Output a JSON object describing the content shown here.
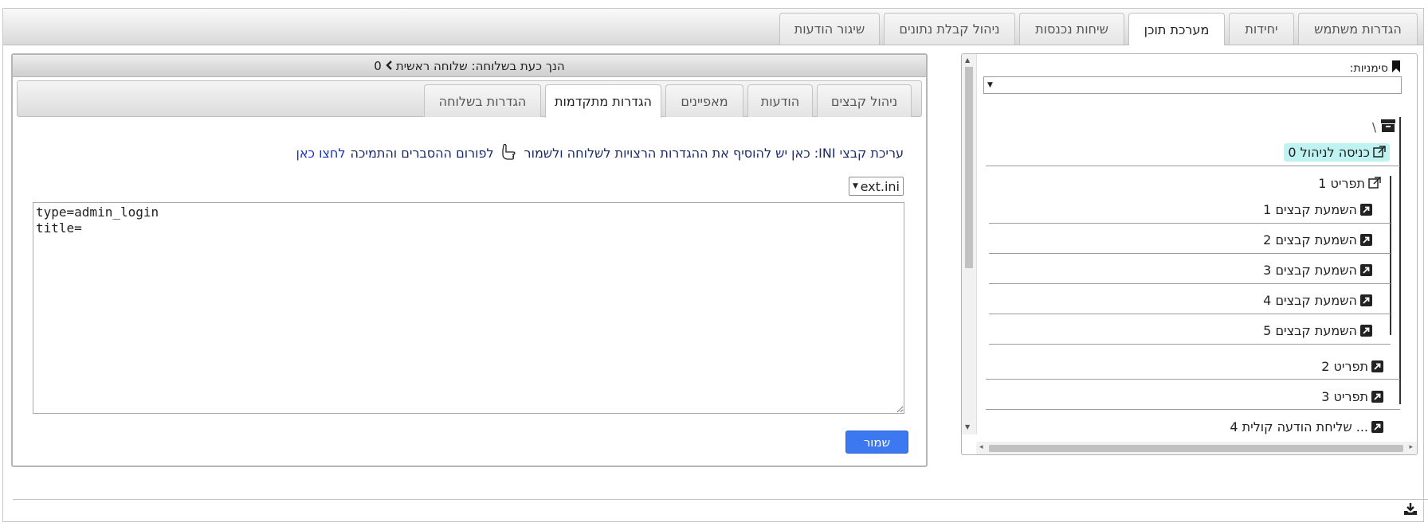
{
  "top_tabs": [
    {
      "label": "הגדרות משתמש"
    },
    {
      "label": "יחידות"
    },
    {
      "label": "מערכת תוכן"
    },
    {
      "label": "שיחות נכנסות"
    },
    {
      "label": "ניהול קבלת נתונים"
    },
    {
      "label": "שיגור הודעות"
    }
  ],
  "main": {
    "header_prefix": "הנך כעת בשלוחה: שלוחה ראשית",
    "header_number": "0",
    "subtabs": [
      {
        "label": "ניהול קבצים"
      },
      {
        "label": "הודעות"
      },
      {
        "label": "מאפיינים"
      },
      {
        "label": "הגדרות מתקדמות"
      },
      {
        "label": "הגדרות בשלוחה"
      }
    ],
    "info_text": "עריכת קבצי INI: כאן יש להוסיף את ההגדרות הרצויות לשלוחה ולשמור",
    "forum_text": "לפורום ההסברים והתמיכה",
    "forum_link": "לחצו כאן",
    "file_select": "ext.ini",
    "editor_content": "type=admin_login\ntitle=",
    "save_label": "שמור"
  },
  "sidebar": {
    "bookmarks_label": "סימניות:",
    "root_label": "\\",
    "items": [
      {
        "label": "0 כניסה לניהול"
      },
      {
        "label": "1 תפריט"
      },
      {
        "label": "1 השמעת קבצים"
      },
      {
        "label": "2 השמעת קבצים"
      },
      {
        "label": "3 השמעת קבצים"
      },
      {
        "label": "4 השמעת קבצים"
      },
      {
        "label": "5 השמעת קבצים"
      },
      {
        "label": "2 תפריט"
      },
      {
        "label": "3 תפריט"
      },
      {
        "label": "4 שליחת הודעה קולית ..."
      }
    ]
  },
  "colors": {
    "accent_button": "#3c78f0",
    "highlight_item": "#bff3f2",
    "link": "#1a33c9"
  },
  "icons": [
    "bookmark-icon",
    "archive-box-icon",
    "external-link-icon",
    "shortcut-arrow-icon",
    "hand-pointer-icon",
    "download-icon"
  ]
}
